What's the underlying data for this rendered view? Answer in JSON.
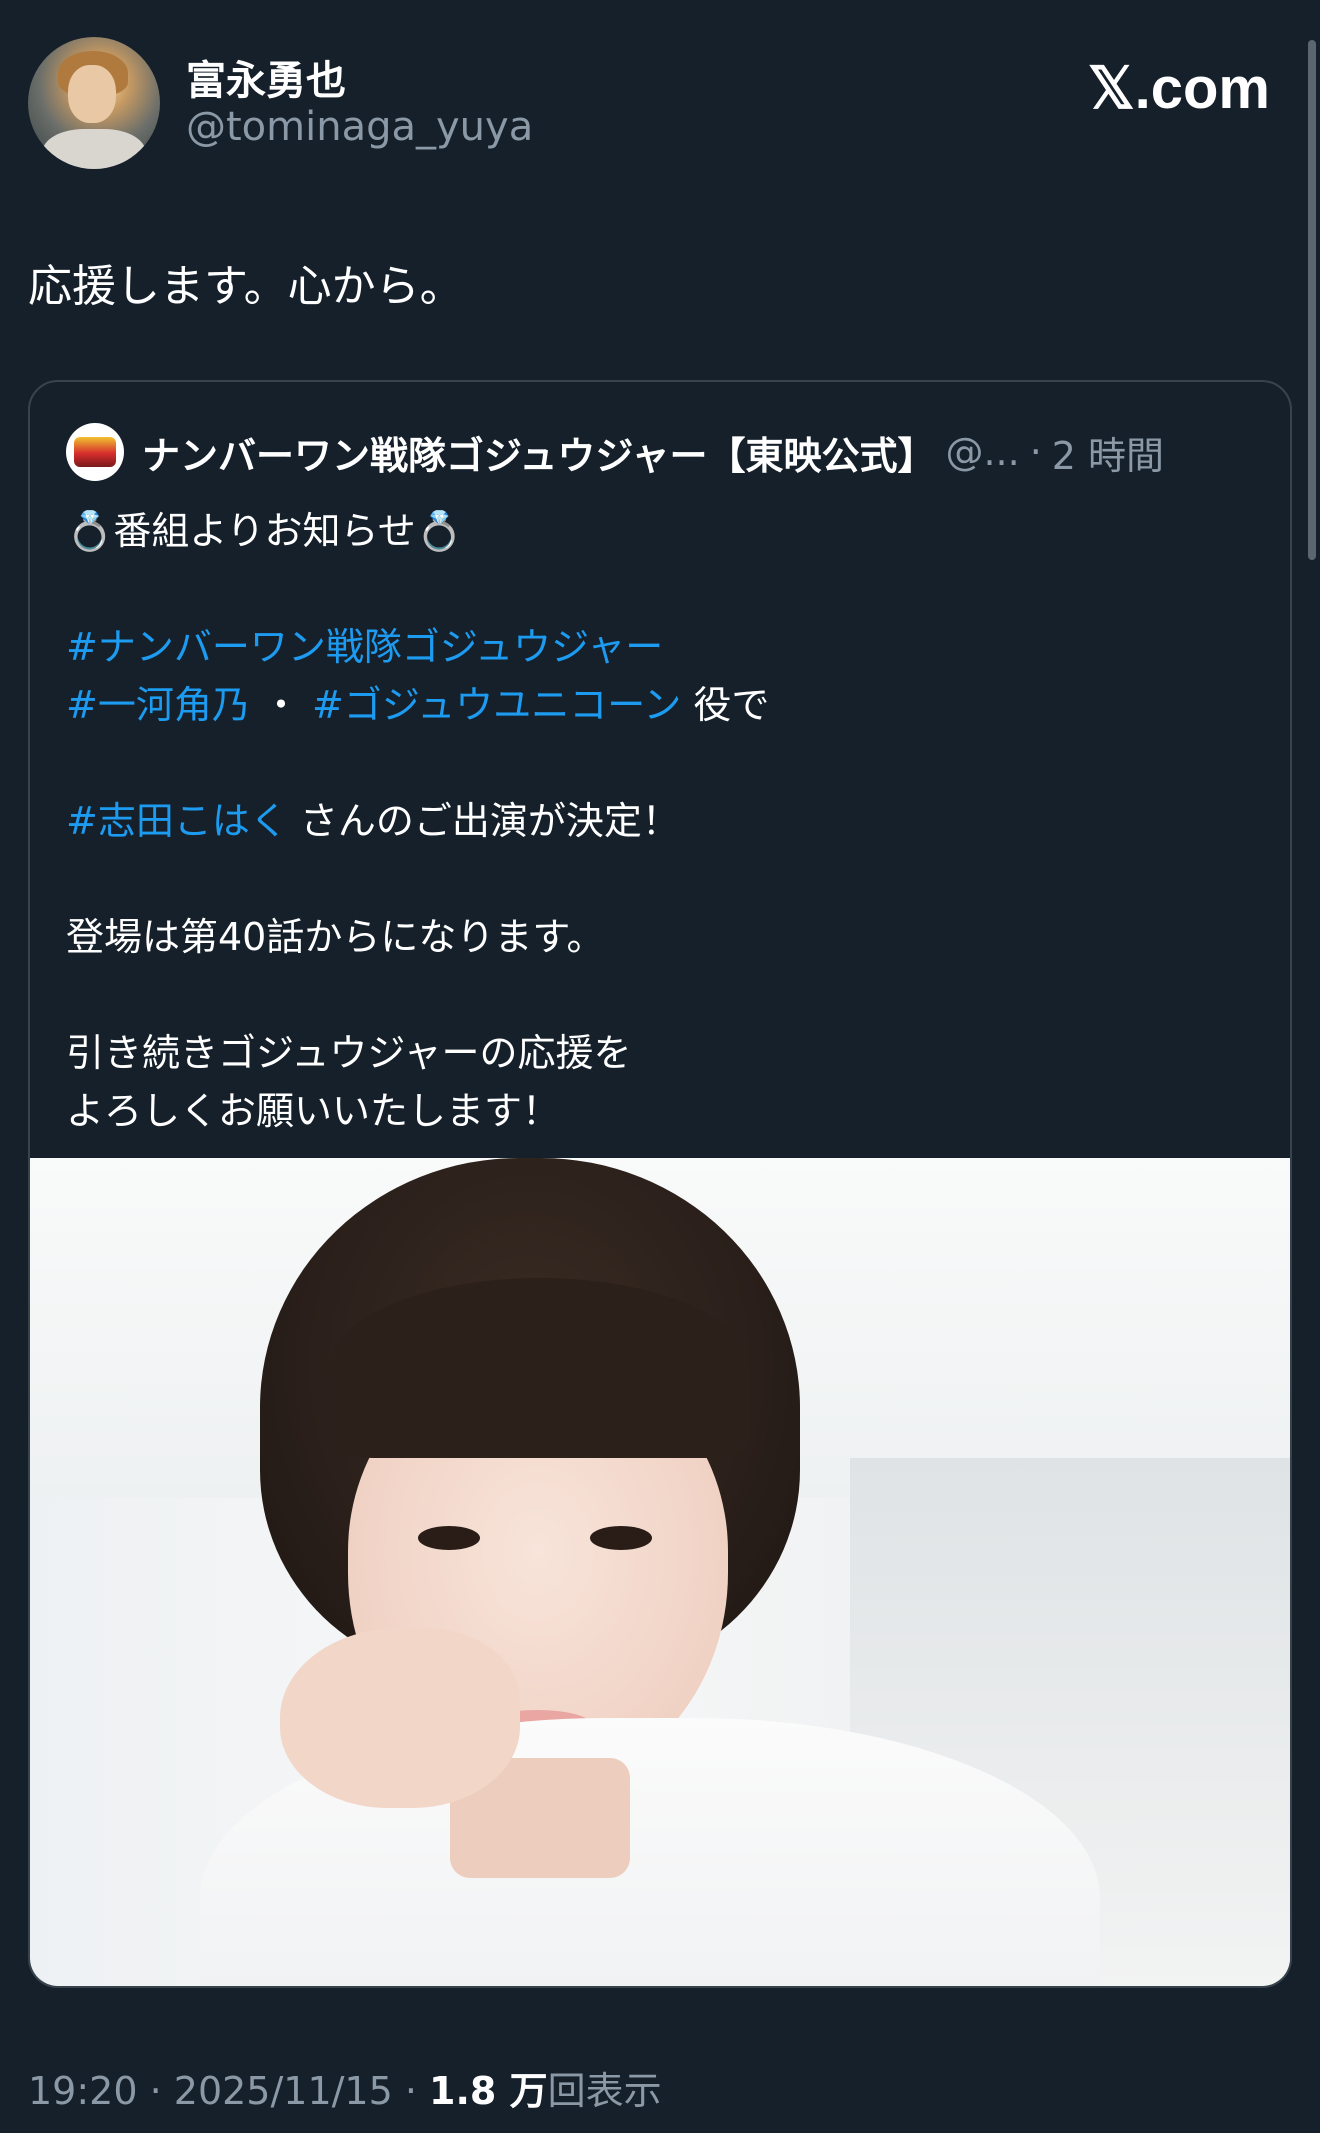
{
  "author": {
    "display_name": "富永勇也",
    "handle": "@tominaga_yuya"
  },
  "site_logo": "𝕏.com",
  "tweet": {
    "text": "応援します。心から。"
  },
  "quote": {
    "name": "ナンバーワン戦隊ゴジュウジャー【東映公式】",
    "handle_truncated": "@...",
    "separator": "·",
    "time": "2 時間",
    "line1": "💍番組よりお知らせ💍",
    "tag_series": "#ナンバーワン戦隊ゴジュウジャー",
    "tag_role": "#一河角乃",
    "middot": "・",
    "tag_unicorn": "#ゴジュウユニコーン",
    "role_suffix": " 役で",
    "tag_actress": "#志田こはく",
    "actress_suffix": " さんのご出演が決定！",
    "line_episode": "登場は第40話からになります。",
    "line_support1": "引き続きゴジュウジャーの応援を",
    "line_support2": "よろしくお願いいたします！"
  },
  "footer": {
    "time": "19:20",
    "sep1": " · ",
    "date": "2025/11/15",
    "sep2": " · ",
    "views_count": "1.8 万",
    "views_label": "回表示"
  },
  "colors": {
    "background": "#15202b",
    "link": "#1d9bf0",
    "secondary_text": "#8b98a5",
    "border": "#38444d"
  },
  "icons": {
    "avatar": "profile-photo",
    "quote_avatar": "sentai-emblem",
    "ring": "ring-emoji"
  }
}
